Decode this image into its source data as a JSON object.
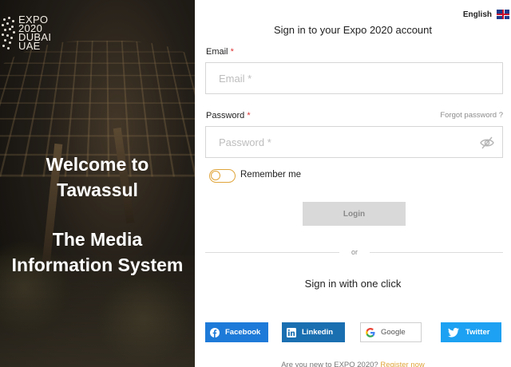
{
  "hero": {
    "logo": {
      "line1": "EXPO",
      "line2": "2020",
      "line3": "DUBAI",
      "line4": "UAE"
    },
    "welcome_line1": "Welcome to",
    "welcome_line2": "Tawassul",
    "system_line1": "The Media",
    "system_line2": "Information System"
  },
  "language": {
    "label": "English",
    "flag_icon": "uk-flag-icon"
  },
  "form": {
    "title": "Sign in to your Expo 2020 account",
    "email_label": "Email",
    "email_placeholder": "Email *",
    "email_value": "",
    "password_label": "Password",
    "password_placeholder": "Password *",
    "password_value": "",
    "required_mark": "*",
    "forgot_password": "Forgot password ?",
    "remember_me": "Remember me",
    "remember_checked": false,
    "login_button": "Login",
    "divider_text": "or",
    "one_click_title": "Sign in with one click"
  },
  "social": [
    {
      "name": "Facebook",
      "icon": "facebook-icon"
    },
    {
      "name": "Linkedin",
      "icon": "linkedin-icon"
    },
    {
      "name": "Google",
      "icon": "google-icon"
    },
    {
      "name": "Twitter",
      "icon": "twitter-icon"
    }
  ],
  "footer": {
    "prompt": "Are you new to EXPO 2020?",
    "register_link": "Register now"
  },
  "colors": {
    "accent": "#e0a53a",
    "facebook": "#1e7ad8",
    "linkedin": "#1a6fb1",
    "twitter": "#1da1f2",
    "login_disabled_bg": "#d9d9d9"
  }
}
